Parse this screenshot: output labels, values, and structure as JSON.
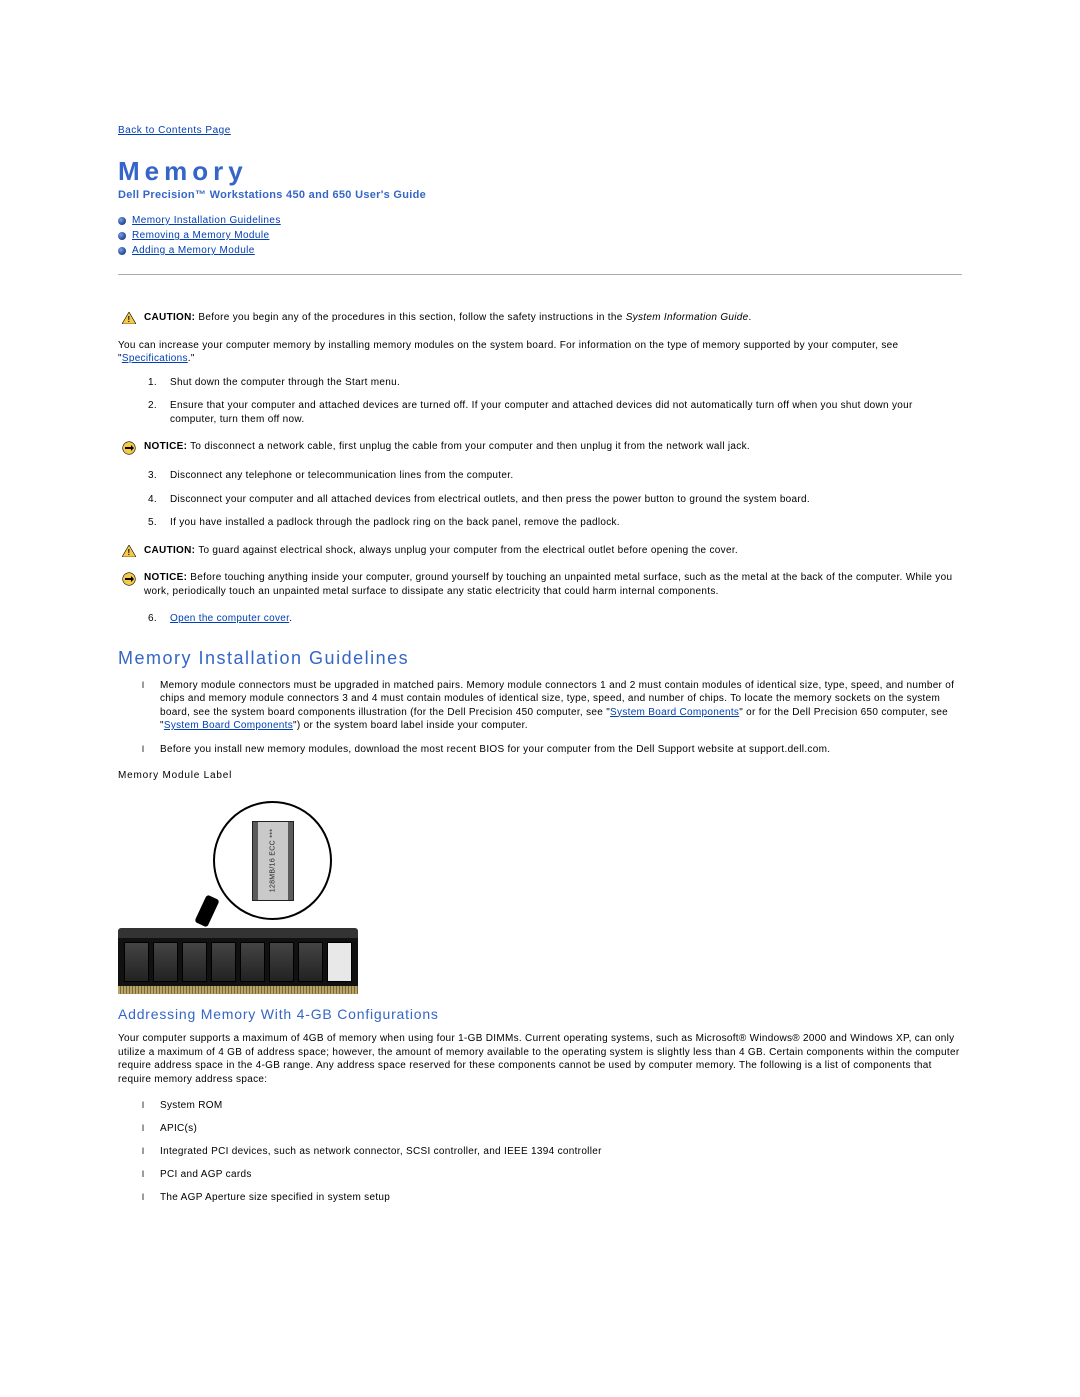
{
  "nav": {
    "back": "Back to Contents Page"
  },
  "header": {
    "title": "Memory",
    "subtitle": "Dell Precision™ Workstations 450 and 650 User's Guide"
  },
  "toc": [
    "Memory Installation Guidelines",
    "Removing a Memory Module",
    "Adding a Memory Module"
  ],
  "callouts": {
    "c1": {
      "label": "CAUTION:",
      "text_pre": " Before you begin any of the procedures in this section, follow the safety instructions in the ",
      "text_italic": "System Information Guide",
      "text_post": "."
    },
    "notice1": {
      "label": "NOTICE:",
      "text": " To disconnect a network cable, first unplug the cable from your computer and then unplug it from the network wall jack."
    },
    "c2": {
      "label": "CAUTION:",
      "text": " To guard against electrical shock, always unplug your computer from the electrical outlet before opening the cover."
    },
    "notice2": {
      "label": "NOTICE:",
      "text": " Before touching anything inside your computer, ground yourself by touching an unpainted metal surface, such as the metal at the back of the computer. While you work, periodically touch an unpainted metal surface to dissipate any static electricity that could harm internal components."
    }
  },
  "intro": {
    "p1_pre": " You can increase your computer memory by installing memory modules on the system board. For information on the type of memory supported by your computer, see \"",
    "p1_link": "Specifications",
    "p1_post": ".\""
  },
  "steps_a": [
    "Shut down the computer through the Start menu.",
    "Ensure that your computer and attached devices are turned off. If your computer and attached devices did not automatically turn off when you shut down your computer, turn them off now."
  ],
  "steps_b": [
    "Disconnect any telephone or telecommunication lines from the computer.",
    "Disconnect your computer and all attached devices from electrical outlets, and then press the power button to ground the system board.",
    "If you have installed a padlock through the padlock ring on the back panel, remove the padlock."
  ],
  "step6_link": "Open the computer cover",
  "step6_post": ".",
  "section1": {
    "heading": "Memory Installation Guidelines",
    "b1_pre": "Memory module connectors must be upgraded in matched pairs. Memory module connectors 1 and 2 must contain modules of identical size, type, speed, and number of chips and memory module connectors 3 and 4 must contain modules of identical size, type, speed, and number of chips. To locate the memory sockets on the system board, see the system board components illustration (for the Dell Precision 450 computer, see \"",
    "b1_link1": "System Board Components",
    "b1_mid": "\" or for the Dell Precision 650 computer, see \"",
    "b1_link2": "System Board Components",
    "b1_post": "\") or the system board label inside your computer.",
    "b2": "Before you install new memory modules, download the most recent BIOS for your computer from the Dell Support website at support.dell.com.",
    "mem_label": "Memory Module Label",
    "chip_text": "128MB/16 ECC ***"
  },
  "section2": {
    "heading": "Addressing Memory With 4-GB Configurations",
    "p1": " Your computer supports a maximum of 4GB of memory when using four 1-GB DIMMs. Current operating systems, such as Microsoft® Windows® 2000 and Windows XP, can only utilize a maximum of 4 GB of address space; however, the amount of memory available to the operating system is slightly less than 4 GB. Certain components within the computer require address space in the 4-GB range. Any address space reserved for these components cannot be used by computer memory. The following is a list of components that require memory address space:",
    "items": [
      "System ROM",
      "APIC(s)",
      "Integrated PCI devices, such as network connector, SCSI controller, and IEEE 1394 controller",
      "PCI and AGP cards",
      "The AGP Aperture size specified in system setup"
    ]
  }
}
